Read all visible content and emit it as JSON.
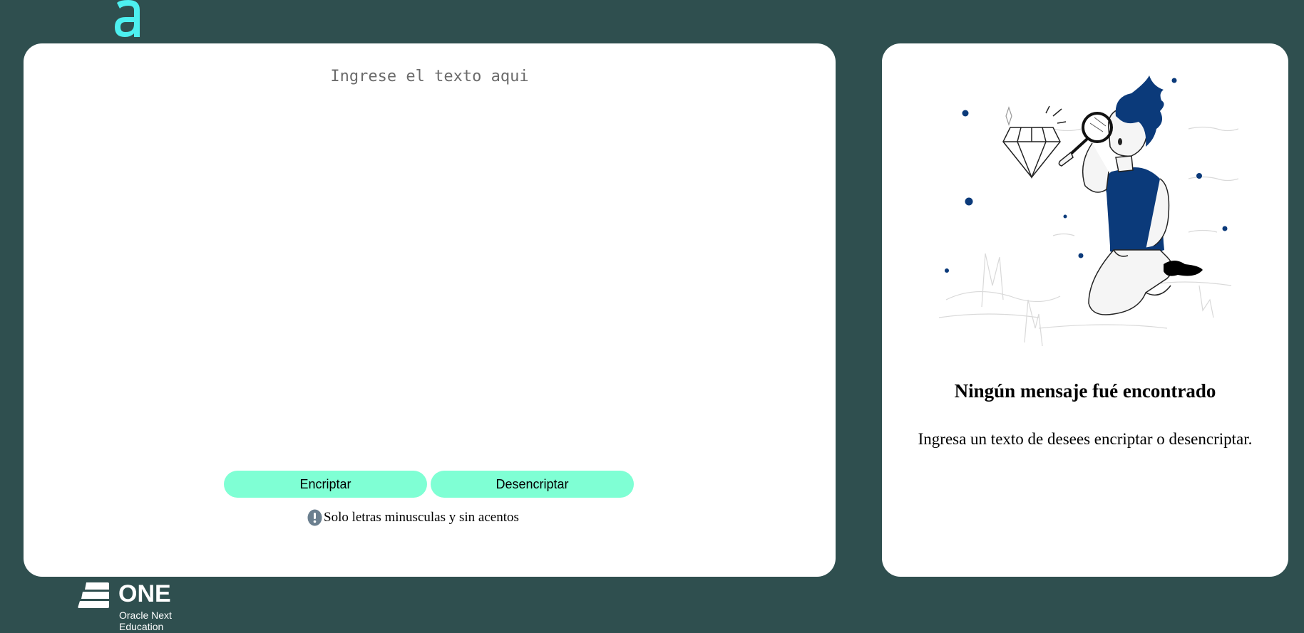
{
  "colors": {
    "background": "#2f4f4f",
    "panel": "#ffffff",
    "button": "#7fffd4",
    "logo_accent": "#4df0f0",
    "illustration_blue": "#0b3a7a"
  },
  "header": {
    "logo_icon": "alura-a-logo"
  },
  "editor": {
    "placeholder": "Ingrese el texto aqui",
    "value": ""
  },
  "actions": {
    "encrypt_label": "Encriptar",
    "decrypt_label": "Desencriptar"
  },
  "hint": {
    "icon": "exclamation-circle-icon",
    "text": "Solo letras minusculas y sin acentos"
  },
  "output": {
    "illustration": "person-with-magnifier-diamond",
    "title": "Ningún mensaje fué encontrado",
    "message": "Ingresa un texto de desees encriptar o desencriptar."
  },
  "footer": {
    "brand": "ONE",
    "subtitle_line1": "Oracle Next",
    "subtitle_line2": "Education"
  }
}
